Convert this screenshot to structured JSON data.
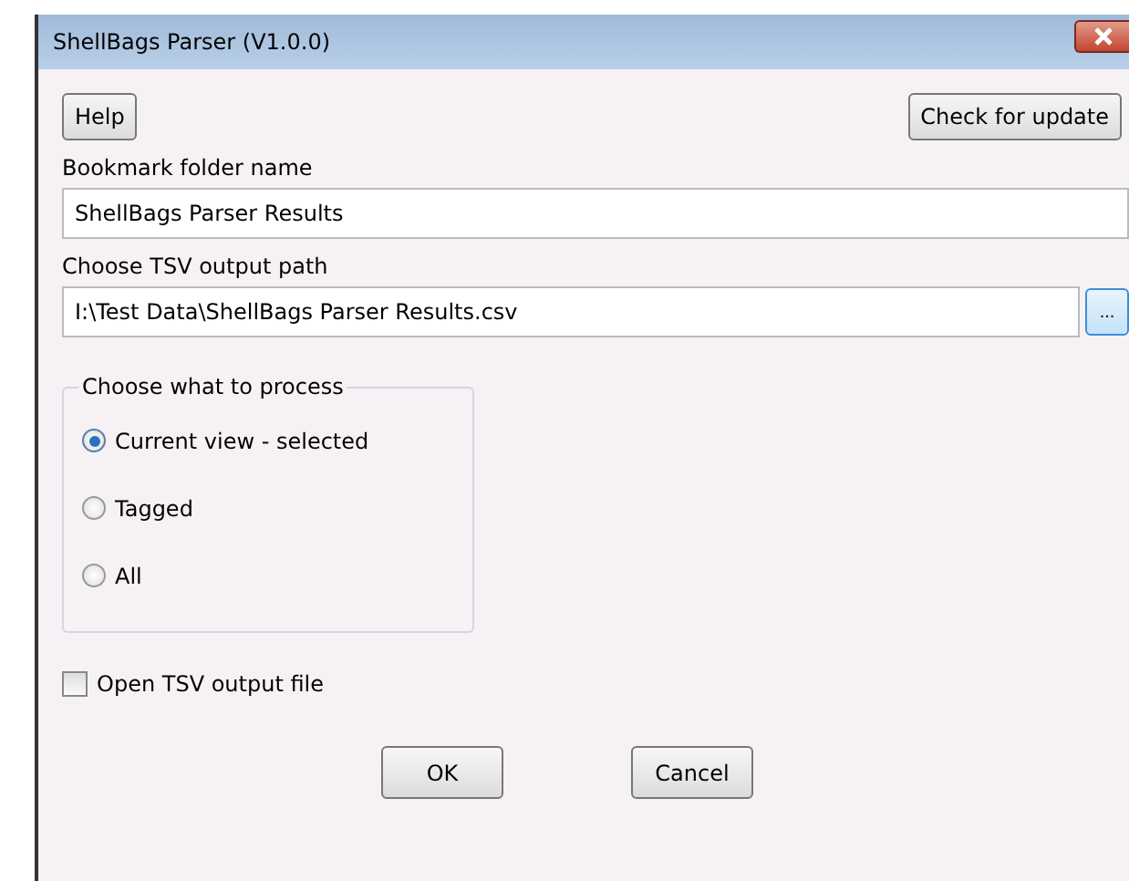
{
  "window": {
    "title": "ShellBags Parser (V1.0.0)"
  },
  "top_buttons": [
    "Help",
    "Check for update"
  ],
  "bookmark": {
    "label": "Bookmark folder name",
    "value": "ShellBags Parser Results"
  },
  "output_path": {
    "label": "Choose TSV output path",
    "value": "I:\\Test Data\\ShellBags Parser Results.csv",
    "browse_label": "..."
  },
  "process": {
    "title": "Choose what to process",
    "options": [
      {
        "label": "Current view - selected",
        "selected": true
      },
      {
        "label": "Tagged",
        "selected": false
      },
      {
        "label": "All",
        "selected": false
      }
    ]
  },
  "open_output": {
    "label": "Open TSV output file",
    "checked": false
  },
  "buttons": [
    "OK",
    "Cancel"
  ]
}
